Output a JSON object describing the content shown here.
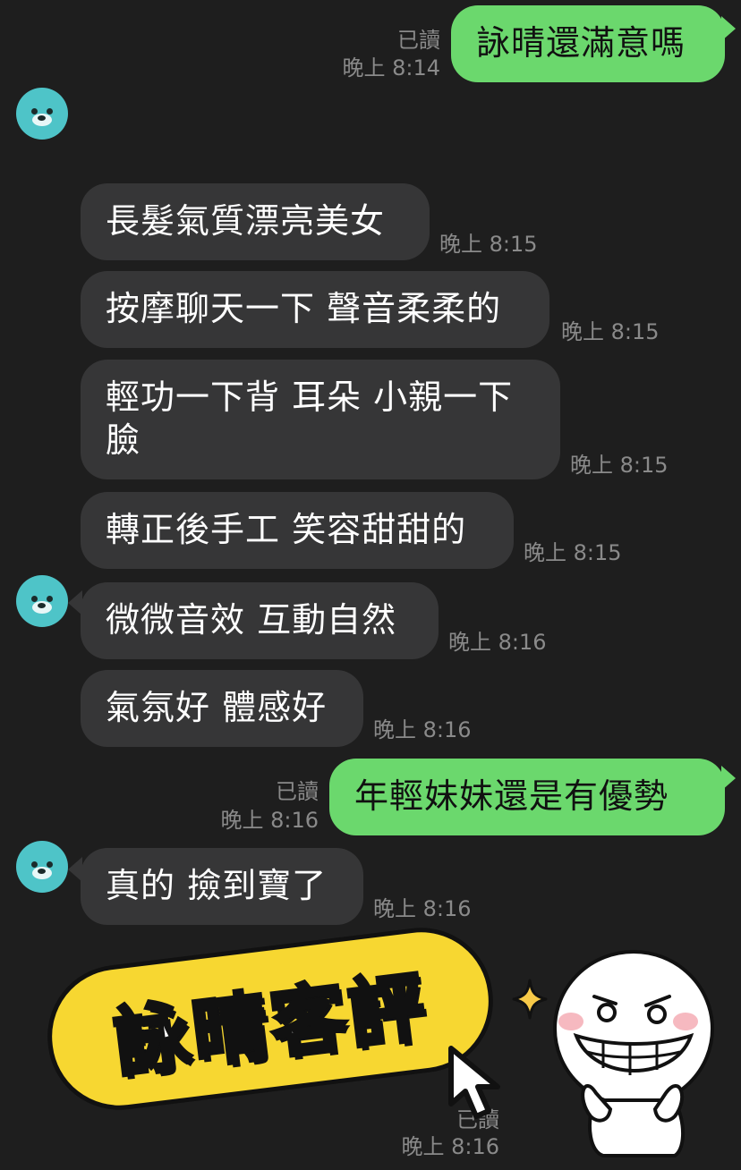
{
  "messages": [
    {
      "dir": "out",
      "text": "詠晴還滿意嗎",
      "read": "已讀",
      "time": "晚上 8:14"
    },
    {
      "dir": "in",
      "text": "長髮氣質漂亮美女",
      "time": "晚上 8:15"
    },
    {
      "dir": "in",
      "text": "按摩聊天一下 聲音柔柔的",
      "time": "晚上 8:15"
    },
    {
      "dir": "in",
      "text": "輕功一下背 耳朵 小親一下",
      "text2": "臉",
      "time": "晚上 8:15"
    },
    {
      "dir": "in",
      "text": "轉正後手工 笑容甜甜的",
      "time": "晚上 8:15"
    },
    {
      "dir": "in",
      "text": "微微音效 互動自然",
      "time": "晚上 8:16"
    },
    {
      "dir": "in",
      "text": "氣氛好 體感好",
      "time": "晚上 8:16"
    },
    {
      "dir": "out",
      "text": "年輕妹妹還是有優勢",
      "read": "已讀",
      "time": "晚上 8:16"
    },
    {
      "dir": "in",
      "text": "真的 撿到寶了",
      "time": "晚上 8:16"
    }
  ],
  "last_status": {
    "read": "已讀",
    "time": "晚上 8:16"
  },
  "banner": {
    "text": "詠晴客評",
    "color": "#f7d731"
  },
  "colors": {
    "background": "#1e1e1e",
    "incoming_bubble": "#363637",
    "outgoing_bubble": "#6bd86d",
    "avatar": "#4ec4c8"
  },
  "icons": [
    "bear-avatar-icon",
    "cursor-arrow-icon",
    "sparkle-icon",
    "laughing-face-sticker-icon"
  ]
}
